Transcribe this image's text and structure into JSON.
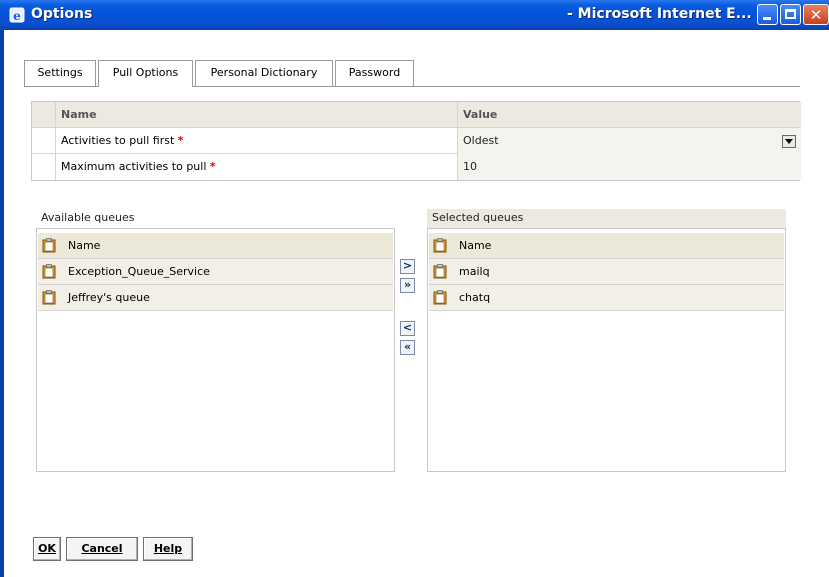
{
  "window": {
    "title": "Options",
    "title_right": "- Microsoft Internet E...",
    "colors": {
      "titlebar": "#0552d6",
      "close": "#c8401a"
    }
  },
  "tabs": [
    {
      "label": "Settings",
      "active": false
    },
    {
      "label": "Pull Options",
      "active": true
    },
    {
      "label": "Personal Dictionary",
      "active": false
    },
    {
      "label": "Password",
      "active": false
    }
  ],
  "grid": {
    "header": {
      "name": "Name",
      "value": "Value"
    },
    "rows": [
      {
        "name": "Activities to pull first",
        "required_mark": "*",
        "value": "Oldest"
      },
      {
        "name": "Maximum activities to pull",
        "required_mark": "*",
        "value": "10"
      }
    ]
  },
  "available": {
    "label": "Available queues",
    "header": "Name",
    "items": [
      "Exception_Queue_Service",
      "Jeffrey's queue"
    ]
  },
  "selected": {
    "label": "Selected queues",
    "header": "Name",
    "items": [
      "mailq",
      "chatq"
    ]
  },
  "move_buttons": {
    "add": ">",
    "add_all": "»",
    "remove": "<",
    "remove_all": "«"
  },
  "footer": {
    "ok": "OK",
    "cancel": "Cancel",
    "help": "Help"
  },
  "icons": {
    "window_icon": "ie-icon",
    "queue_icon": "queue-clipboard-icon",
    "dropdown": "chevron-down-icon"
  }
}
